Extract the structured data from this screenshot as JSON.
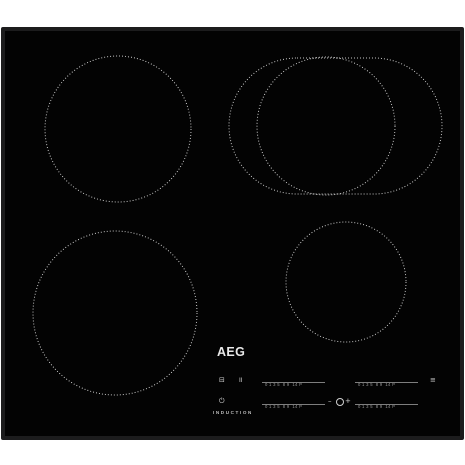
{
  "product": {
    "brand": "AEG",
    "technology_label": "INDUCTION"
  },
  "zones": [
    {
      "name": "rear-left",
      "shape": "circle"
    },
    {
      "name": "rear-right",
      "shape": "dual-oval"
    },
    {
      "name": "front-left",
      "shape": "circle"
    },
    {
      "name": "front-right",
      "shape": "circle"
    }
  ],
  "controls": {
    "scale_text": "0 1 3 5  8 9  14 P",
    "icons": {
      "lock": "lock-icon",
      "pause": "pause-icon",
      "power": "power-icon",
      "timer": "timer-minus-plus-icon",
      "hob2hood": "hood-icon"
    },
    "glyphs": {
      "lock": "⊟",
      "pause": "II",
      "power": "⏻",
      "timer_minus": "–",
      "timer_plus": "+",
      "hood": "≡"
    }
  },
  "colors": {
    "glass": "#030303",
    "frame": "#1c1c1d",
    "markings": "#e0e0e0"
  }
}
